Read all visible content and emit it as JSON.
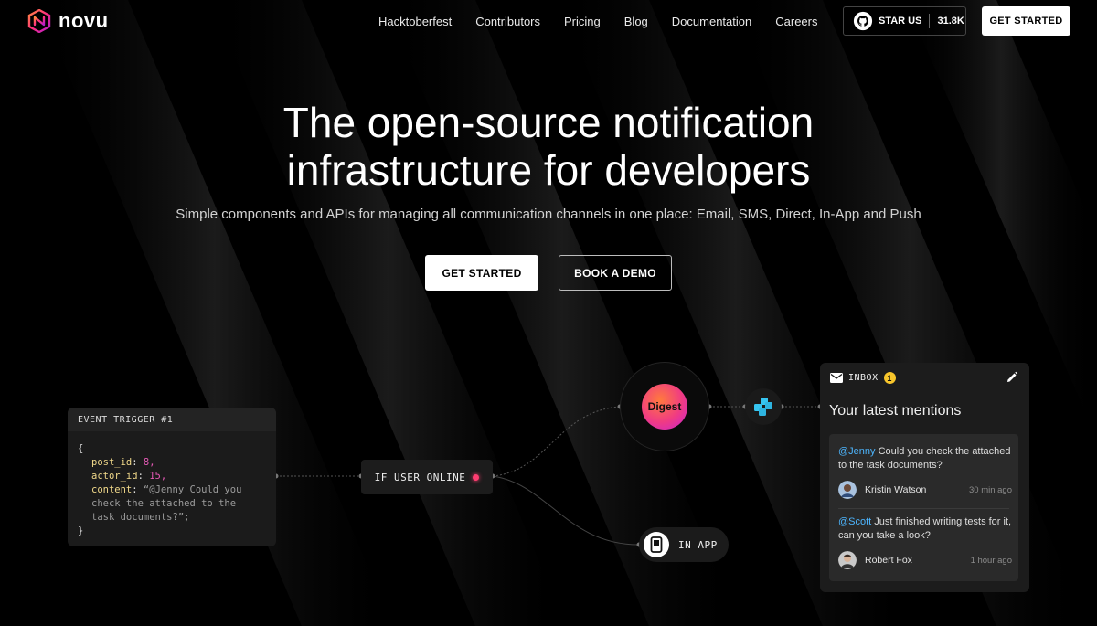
{
  "brand": {
    "name": "novu"
  },
  "nav": {
    "items": [
      "Hacktoberfest",
      "Contributors",
      "Pricing",
      "Blog",
      "Documentation",
      "Careers"
    ]
  },
  "header": {
    "star_label": "STAR US",
    "star_count": "31.8K",
    "cta": "GET STARTED"
  },
  "hero": {
    "title_line1": "The open-source notification",
    "title_line2": "infrastructure for developers",
    "subtitle": "Simple components and APIs for managing all communication channels in one place: Email, SMS, Direct, In-App and Push",
    "primary_cta": "GET STARTED",
    "secondary_cta": "BOOK A DEMO"
  },
  "workflow": {
    "event_title": "EVENT TRIGGER #1",
    "code": {
      "open": "{",
      "k1": "post_id",
      "v1": "8,",
      "k2": "actor_id",
      "v2": "15,",
      "k3": "content",
      "v3a": "“@Jenny Could you",
      "v3b": "check the attached to the",
      "v3c": "task documents?”;",
      "close": "}"
    },
    "condition": "IF USER ONLINE",
    "digest": "Digest",
    "in_app": "IN APP"
  },
  "inbox": {
    "label": "INBOX",
    "count": "1",
    "title": "Your latest mentions",
    "mentions": [
      {
        "handle": "@Jenny",
        "text": " Could you check the attached to the task documents?",
        "name": "Kristin Watson",
        "time": "30 min ago"
      },
      {
        "handle": "@Scott",
        "text": " Just finished writing tests for it, can you take a look?",
        "name": "Robert Fox",
        "time": "1 hour ago"
      }
    ]
  },
  "colors": {
    "accent_pink": "#f03b83",
    "mention_blue": "#4db6ff",
    "badge_yellow": "#f7c52b"
  }
}
